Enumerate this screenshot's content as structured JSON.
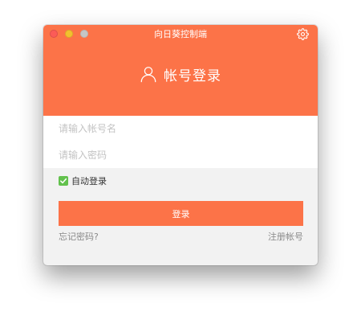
{
  "window": {
    "title": "向日葵控制端"
  },
  "header": {
    "title": "帐号登录"
  },
  "form": {
    "username_placeholder": "请输入帐号名",
    "password_placeholder": "请输入密码",
    "remember_label": "自动登录",
    "remember_checked": true,
    "login_label": "登录"
  },
  "links": {
    "forgot_password": "忘记密码?",
    "register": "注册帐号"
  },
  "colors": {
    "accent": "#fc7348",
    "checkbox": "#62c14d"
  },
  "icons": {
    "settings": "gear-icon",
    "user": "user-icon",
    "check": "checkmark-icon"
  }
}
